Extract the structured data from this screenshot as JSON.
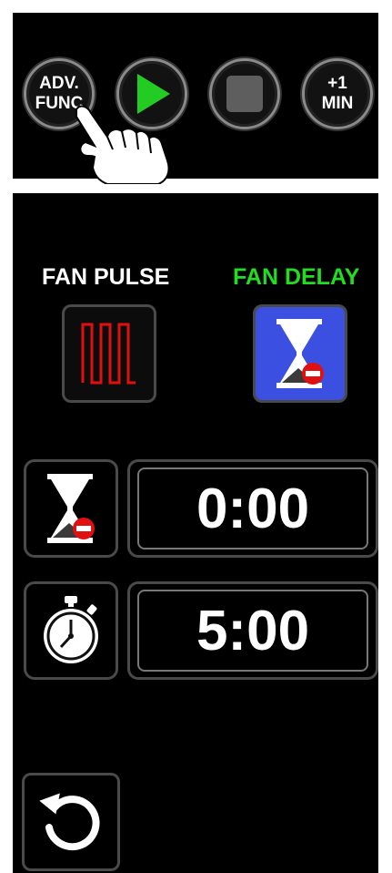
{
  "top_controls": {
    "adv_func": {
      "line1": "ADV.",
      "line2": "FUNC"
    },
    "play_icon": "play-icon",
    "stop_icon": "stop-icon",
    "plus_one_min": {
      "line1": "+1",
      "line2": "MIN"
    }
  },
  "modes": {
    "fan_pulse": {
      "label": "FAN PULSE",
      "color": "#ffffff"
    },
    "fan_delay": {
      "label": "FAN DELAY",
      "color": "#22dd22",
      "selected": true
    }
  },
  "timers": {
    "delay_time": "0:00",
    "run_time": "5:00"
  },
  "colors": {
    "accent_green": "#22cc22",
    "pulse_red": "#e01010",
    "delay_blue": "#3b4fe0",
    "panel_bg": "#000000"
  },
  "icons": {
    "pulse": "pulse-wave-icon",
    "hourglass": "hourglass-icon",
    "stopwatch": "stopwatch-icon",
    "reset": "reset-arrow-icon",
    "hand": "hand-pointer-icon"
  }
}
